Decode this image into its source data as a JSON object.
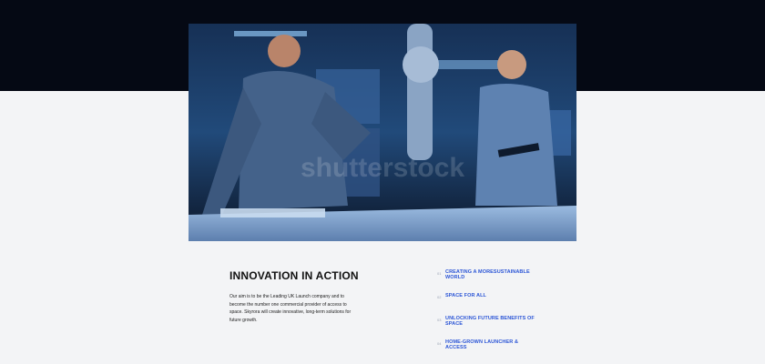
{
  "hero": {
    "image_alt": "Two engineers working at an interactive table in a control room",
    "watermark": "shutterstock"
  },
  "section": {
    "title": "INNOVATION IN ACTION",
    "body": "Our aim is to be the Leading UK Launch company and to become the number one commercial provider of access to space. Skyrora will create innovative, long-term solutions for future growth."
  },
  "links": [
    {
      "num": "01",
      "label": "CREATING A MORESUSTAINABLE WORLD"
    },
    {
      "num": "02",
      "label": "SPACE FOR ALL"
    },
    {
      "num": "03",
      "label": "UNLOCKING FUTURE BENEFITS OF SPACE"
    },
    {
      "num": "04",
      "label": "HOME-GROWN LAUNCHER & ACCESS"
    }
  ],
  "colors": {
    "top_band": "#050914",
    "background": "#f3f4f6",
    "link": "#2b55d6",
    "title": "#111111"
  }
}
